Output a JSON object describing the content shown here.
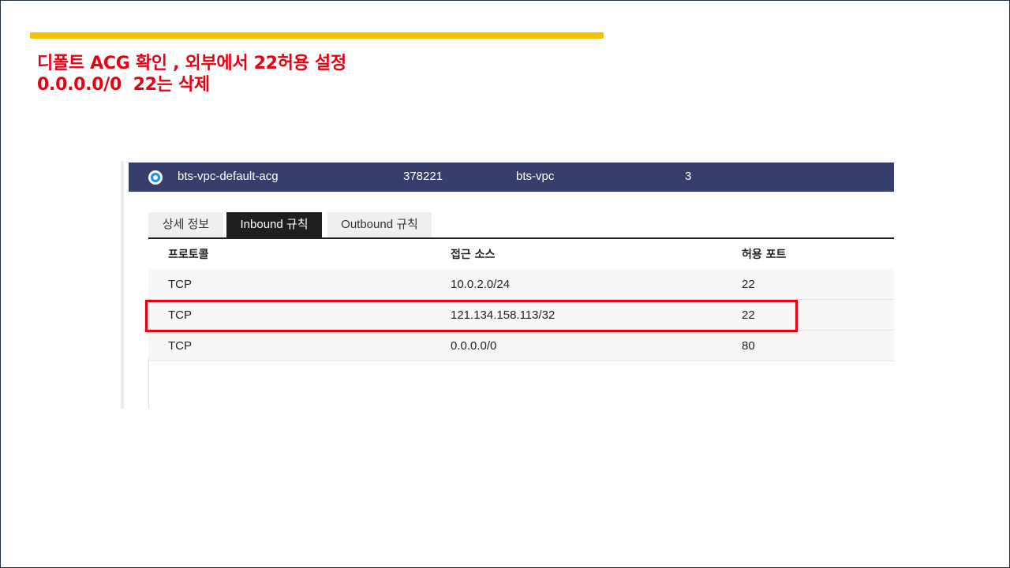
{
  "colors": {
    "accent_bar": "#f7c000",
    "title_red": "#e60012",
    "header_navy": "#363f6b",
    "highlight_red": "#e60012"
  },
  "slide": {
    "title_lines": [
      "디폴트 ACG 확인 , 외부에서 22허용 설정",
      "0.0.0.0/0  22는 삭제"
    ]
  },
  "acg": {
    "name": "bts-vpc-default-acg",
    "id": "378221",
    "vpc": "bts-vpc",
    "count": "3"
  },
  "tabs": [
    {
      "label": "상세 정보",
      "active": false
    },
    {
      "label": "Inbound 규칙",
      "active": true
    },
    {
      "label": "Outbound 규칙",
      "active": false
    }
  ],
  "table": {
    "columns": [
      "프로토콜",
      "접근 소스",
      "허용 포트"
    ],
    "rows": [
      {
        "protocol": "TCP",
        "source": "10.0.2.0/24",
        "port": "22"
      },
      {
        "protocol": "TCP",
        "source": "121.134.158.113/32",
        "port": "22",
        "highlighted": true
      },
      {
        "protocol": "TCP",
        "source": "0.0.0.0/0",
        "port": "80"
      }
    ]
  }
}
